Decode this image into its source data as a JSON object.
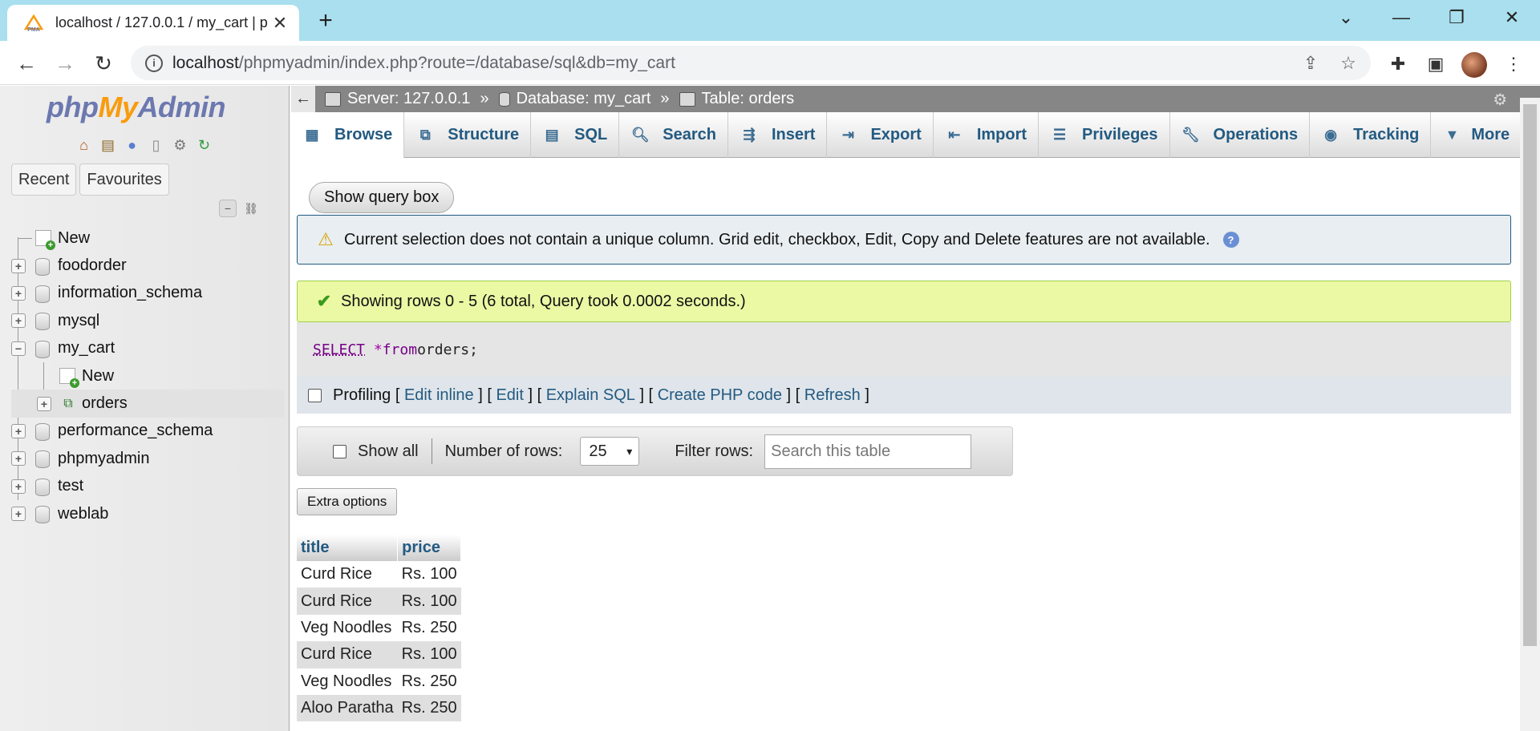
{
  "browser": {
    "tab_title": "localhost / 127.0.0.1 / my_cart | p",
    "tab_close": "✕",
    "new_tab": "+",
    "url_host": "localhost",
    "url_path": "/phpmyadmin/index.php?route=/database/sql&db=my_cart"
  },
  "nav": {
    "logo_php": "php",
    "logo_my": "My",
    "logo_admin": "Admin",
    "tab_recent": "Recent",
    "tab_favourites": "Favourites",
    "tree": {
      "new": "New",
      "dbs": [
        "foodorder",
        "information_schema",
        "mysql",
        "my_cart",
        "performance_schema",
        "phpmyadmin",
        "test",
        "weblab"
      ],
      "child_new": "New",
      "child_table": "orders"
    }
  },
  "breadcrumb": {
    "back": "←",
    "server": "Server: 127.0.0.1",
    "database": "Database: my_cart",
    "table": "Table: orders",
    "sep": "»"
  },
  "menu": {
    "tabs": [
      "Browse",
      "Structure",
      "SQL",
      "Search",
      "Insert",
      "Export",
      "Import",
      "Privileges",
      "Operations",
      "Tracking",
      "More"
    ]
  },
  "main": {
    "show_query_box": "Show query box",
    "notice": "Current selection does not contain a unique column. Grid edit, checkbox, Edit, Copy and Delete features are not available.",
    "success": "Showing rows 0 - 5 (6 total, Query took 0.0002 seconds.)",
    "sql_select": "SELECT",
    "sql_star": "*",
    "sql_from": "from",
    "sql_rest": " orders;",
    "profiling_label": "Profiling",
    "links": [
      "Edit inline",
      "Edit",
      "Explain SQL",
      "Create PHP code",
      "Refresh"
    ],
    "show_all": "Show all",
    "number_of_rows_label": "Number of rows:",
    "number_of_rows_value": "25",
    "filter_rows_label": "Filter rows:",
    "filter_placeholder": "Search this table",
    "extra_options": "Extra options"
  },
  "table": {
    "headers": [
      "title",
      "price"
    ],
    "rows": [
      [
        "Curd Rice",
        "Rs. 100"
      ],
      [
        "Curd Rice",
        "Rs. 100"
      ],
      [
        "Veg Noodles",
        "Rs. 250"
      ],
      [
        "Curd Rice",
        "Rs. 100"
      ],
      [
        "Veg Noodles",
        "Rs. 250"
      ],
      [
        "Aloo Paratha",
        "Rs. 250"
      ]
    ]
  },
  "colors": {
    "link": "#235a81",
    "notice_bg": "#e8eef1",
    "success_bg": "#ebf8a4",
    "tabbar_bg": "#a9dfee"
  }
}
